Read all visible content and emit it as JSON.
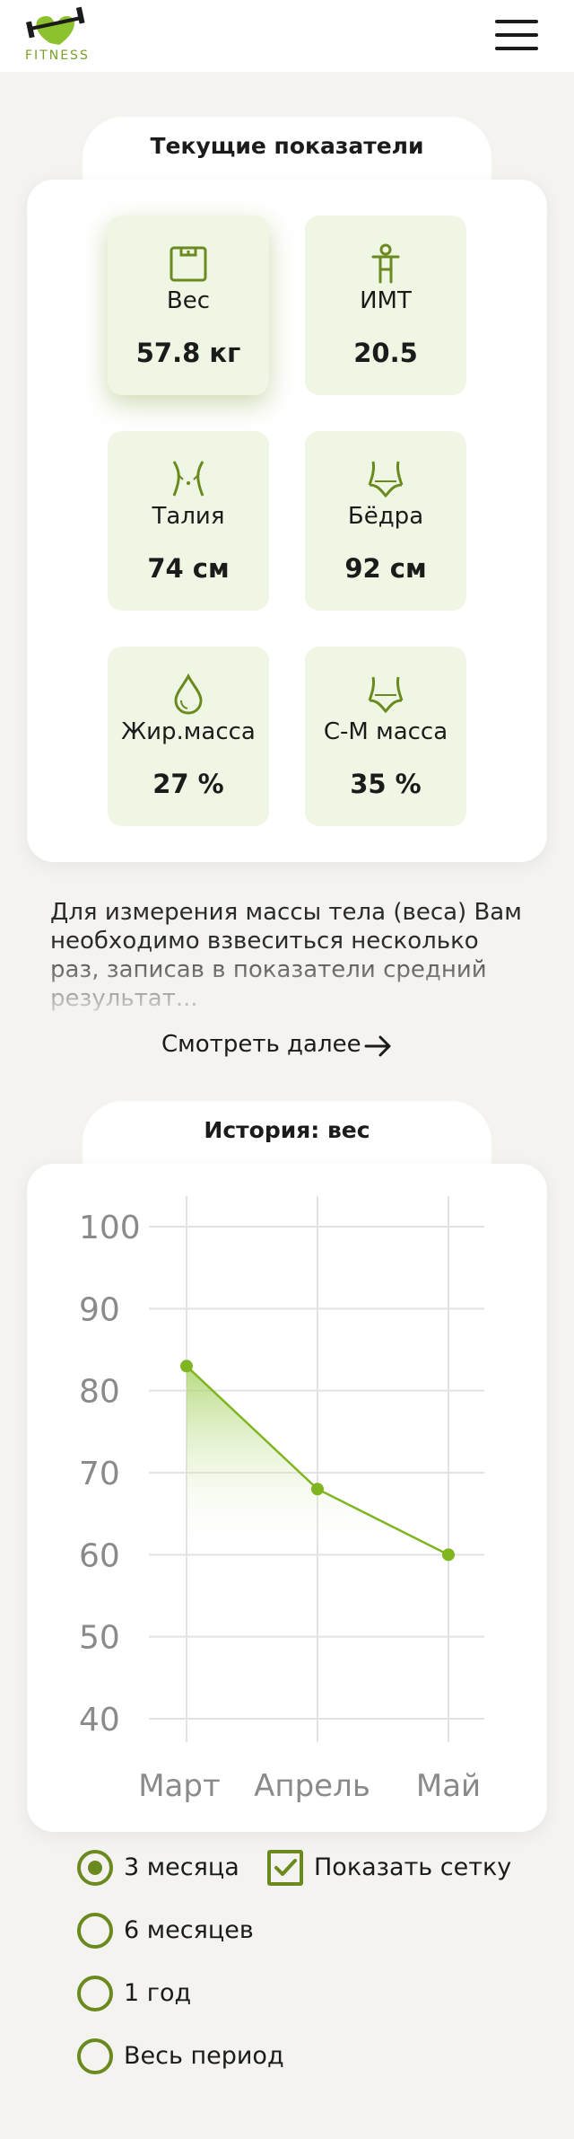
{
  "header": {
    "logo_text": "FITNESS"
  },
  "current": {
    "title": "Текущие показатели",
    "tiles": [
      {
        "label": "Вес",
        "value": "57.8 кг",
        "icon": "scale-icon",
        "active": true
      },
      {
        "label": "ИМТ",
        "value": "20.5",
        "icon": "body-icon",
        "active": false
      },
      {
        "label": "Талия",
        "value": "74 см",
        "icon": "waist-icon",
        "active": false
      },
      {
        "label": "Бёдра",
        "value": "92 см",
        "icon": "hips-icon",
        "active": false
      },
      {
        "label": "Жир.масса",
        "value": "27 %",
        "icon": "fat-drop-icon",
        "active": false
      },
      {
        "label": "С-М масса",
        "value": "35 %",
        "icon": "muscle-mass-icon",
        "active": false
      }
    ]
  },
  "info": {
    "text": "Для измерения массы тела (веса) Вам необходимо взвеситься несколько раз, записав в показатели средний результат...",
    "more_label": "Смотреть далее"
  },
  "history": {
    "title": "История: вес"
  },
  "chart_data": {
    "type": "area",
    "title": "История: вес",
    "categories": [
      "Март",
      "Апрель",
      "Май"
    ],
    "series": [
      {
        "values": [
          83,
          68,
          60
        ]
      }
    ],
    "ylim": [
      40,
      100
    ],
    "yticks": [
      100,
      90,
      80,
      70,
      60,
      50,
      40
    ],
    "grid": true,
    "color": "#7fb51f"
  },
  "options": {
    "periods": [
      {
        "label": "3 месяца",
        "checked": true
      },
      {
        "label": "6 месяцев",
        "checked": false
      },
      {
        "label": "1 год",
        "checked": false
      },
      {
        "label": "Весь период",
        "checked": false
      }
    ],
    "grid_toggle": {
      "label": "Показать сетку",
      "checked": true
    }
  },
  "colors": {
    "accent": "#6a8a1f",
    "tile_bg": "#eff6e3",
    "page_bg": "#f4f3ef"
  }
}
